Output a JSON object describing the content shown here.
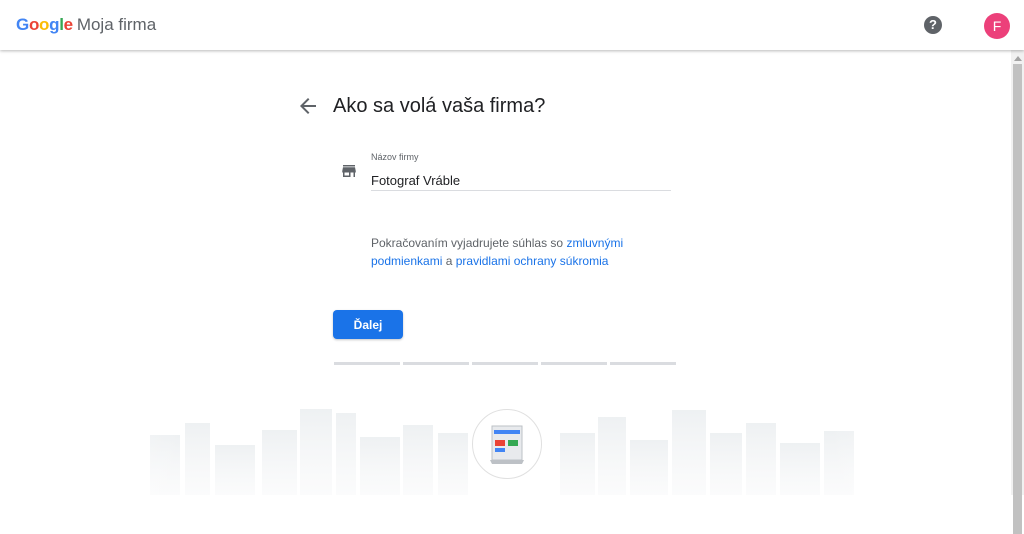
{
  "header": {
    "brand_google_letters": [
      "G",
      "o",
      "o",
      "g",
      "l",
      "e"
    ],
    "product_name": "Moja firma",
    "help_icon": "?",
    "avatar_initial": "F"
  },
  "main": {
    "title": "Ako sa volá vaša firma?",
    "field": {
      "label": "Názov firmy",
      "value": "Fotograf Vráble"
    },
    "terms": {
      "prefix": "Pokračovaním vyjadrujete súhlas so ",
      "link1": "zmluvnými podmienkami",
      "middle": " a ",
      "link2": "pravidlami ochrany súkromia"
    },
    "next_button": "Ďalej",
    "progress": {
      "steps_total": 5,
      "steps_completed": 0
    }
  },
  "colors": {
    "accent": "#1a73e8",
    "avatar": "#EC407A"
  },
  "icons": [
    "back-arrow-icon",
    "help-icon",
    "store-icon",
    "storefront-badge-icon"
  ]
}
